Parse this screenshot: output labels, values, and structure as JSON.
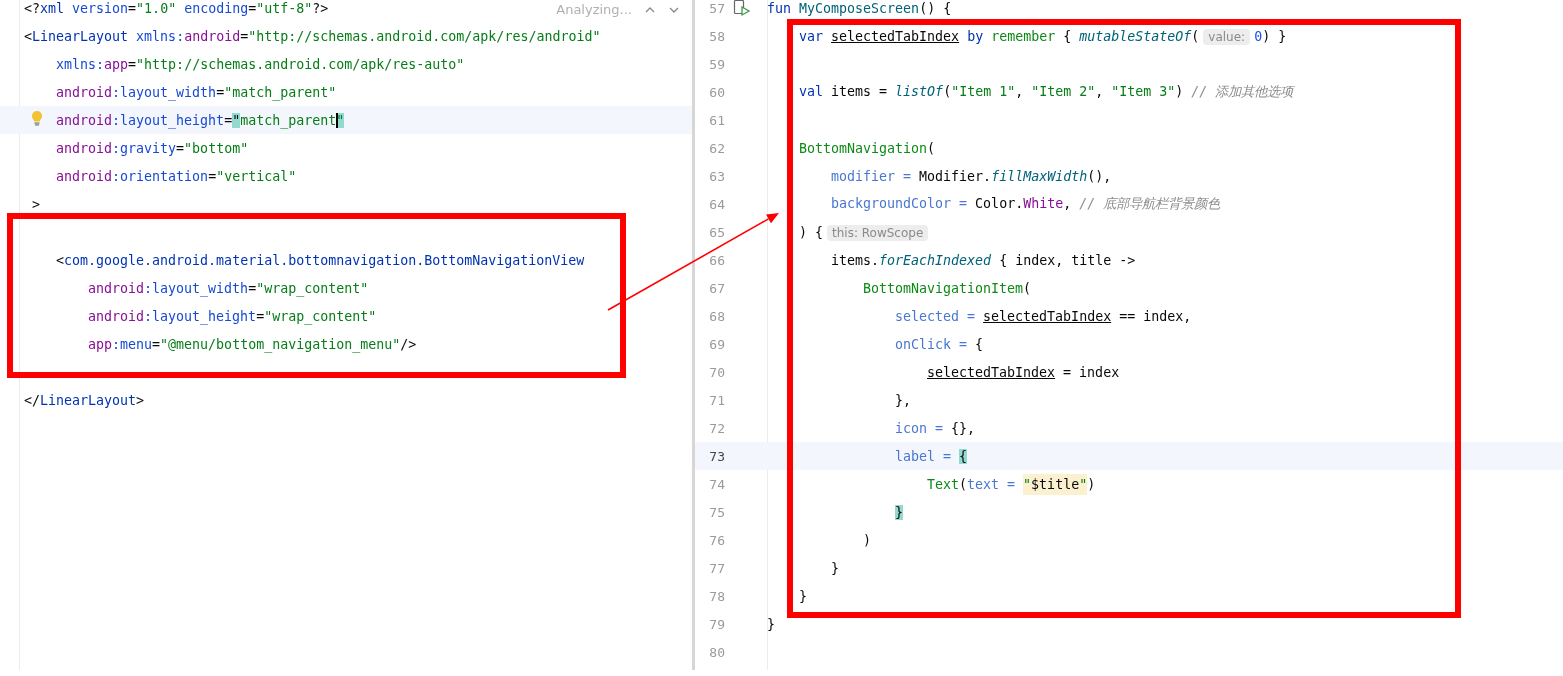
{
  "xml_editor": {
    "status": "Analyzing...",
    "lines": [
      {
        "kind": "code",
        "current": false,
        "bulb": false,
        "tokens": [
          {
            "text": "<?",
            "kind": "punct"
          },
          {
            "text": "xml",
            "kind": "tag"
          },
          {
            "text": " version",
            "kind": "attr"
          },
          {
            "text": "=",
            "kind": "punct"
          },
          {
            "text": "\"1.0\"",
            "kind": "string"
          },
          {
            "text": " encoding",
            "kind": "attr"
          },
          {
            "text": "=",
            "kind": "punct"
          },
          {
            "text": "\"utf-8\"",
            "kind": "string"
          },
          {
            "text": "?>",
            "kind": "punct"
          }
        ]
      },
      {
        "kind": "code",
        "current": false,
        "bulb": false,
        "tokens": [
          {
            "text": "<",
            "kind": "punct"
          },
          {
            "text": "LinearLayout",
            "kind": "tag"
          },
          {
            "text": " xmlns:",
            "kind": "attr"
          },
          {
            "text": "android",
            "kind": "ns"
          },
          {
            "text": "=",
            "kind": "punct"
          },
          {
            "text": "\"http://schemas.android.com/apk/res/android\"",
            "kind": "string"
          }
        ],
        "children": [
          {
            "kind": "code",
            "current": false,
            "bulb": false,
            "tokens": [
              {
                "text": "xmlns:",
                "kind": "attr"
              },
              {
                "text": "app",
                "kind": "ns"
              },
              {
                "text": "=",
                "kind": "punct"
              },
              {
                "text": "\"http://schemas.android.com/apk/res-auto\"",
                "kind": "string"
              }
            ]
          },
          {
            "kind": "code",
            "current": false,
            "bulb": false,
            "tokens": [
              {
                "text": "android",
                "kind": "ns"
              },
              {
                "text": ":layout_width",
                "kind": "attr"
              },
              {
                "text": "=",
                "kind": "punct"
              },
              {
                "text": "\"match_parent\"",
                "kind": "string"
              }
            ]
          },
          {
            "kind": "code",
            "current": true,
            "bulb": true,
            "tokens": [
              {
                "text": "android",
                "kind": "ns"
              },
              {
                "text": ":layout_height",
                "kind": "attr"
              },
              {
                "text": "=",
                "kind": "punct"
              },
              {
                "text": "\"",
                "kind": "match"
              },
              {
                "text": "match_parent",
                "kind": "string"
              },
              {
                "text": "\"",
                "kind": "match-caret"
              }
            ]
          },
          {
            "kind": "code",
            "current": false,
            "bulb": false,
            "tokens": [
              {
                "text": "android",
                "kind": "ns"
              },
              {
                "text": ":gravity",
                "kind": "attr"
              },
              {
                "text": "=",
                "kind": "punct"
              },
              {
                "text": "\"bottom\"",
                "kind": "string"
              }
            ]
          },
          {
            "kind": "code",
            "current": false,
            "bulb": false,
            "tokens": [
              {
                "text": "android",
                "kind": "ns"
              },
              {
                "text": ":orientation",
                "kind": "attr"
              },
              {
                "text": "=",
                "kind": "punct"
              },
              {
                "text": "\"vertical\"",
                "kind": "string"
              }
            ]
          }
        ]
      },
      {
        "kind": "code",
        "current": false,
        "bulb": false,
        "tokens": [
          {
            "text": " >",
            "kind": "punct"
          }
        ],
        "children": [
          {
            "kind": "blank",
            "current": false,
            "bulb": false
          },
          {
            "kind": "code",
            "current": false,
            "bulb": false,
            "tokens": [
              {
                "text": "<",
                "kind": "punct"
              },
              {
                "text": "com.google.android.material.bottomnavigation.BottomNavigationView",
                "kind": "tag"
              }
            ],
            "children": [
              {
                "kind": "code",
                "current": false,
                "bulb": false,
                "tokens": [
                  {
                    "text": "android",
                    "kind": "ns"
                  },
                  {
                    "text": ":layout_width",
                    "kind": "attr"
                  },
                  {
                    "text": "=",
                    "kind": "punct"
                  },
                  {
                    "text": "\"wrap_content\"",
                    "kind": "string"
                  }
                ]
              },
              {
                "kind": "code",
                "current": false,
                "bulb": false,
                "tokens": [
                  {
                    "text": "android",
                    "kind": "ns"
                  },
                  {
                    "text": ":layout_height",
                    "kind": "attr"
                  },
                  {
                    "text": "=",
                    "kind": "punct"
                  },
                  {
                    "text": "\"wrap_content\"",
                    "kind": "string"
                  }
                ]
              },
              {
                "kind": "code",
                "current": false,
                "bulb": false,
                "tokens": [
                  {
                    "text": "app",
                    "kind": "ns"
                  },
                  {
                    "text": ":menu",
                    "kind": "attr"
                  },
                  {
                    "text": "=",
                    "kind": "punct"
                  },
                  {
                    "text": "\"@menu/bottom_navigation_menu\"",
                    "kind": "string"
                  },
                  {
                    "text": "/>",
                    "kind": "punct"
                  }
                ]
              }
            ]
          }
        ]
      },
      {
        "kind": "blank",
        "current": false,
        "bulb": false
      },
      {
        "kind": "code",
        "current": false,
        "bulb": false,
        "tokens": [
          {
            "text": "</",
            "kind": "punct"
          },
          {
            "text": "LinearLayout",
            "kind": "tag"
          },
          {
            "text": ">",
            "kind": "punct"
          }
        ]
      }
    ]
  },
  "kotlin_editor": {
    "lines": [
      {
        "number": "57",
        "kind": "code",
        "current": false,
        "run": true,
        "tokens": [
          {
            "text": "fun ",
            "kind": "kw"
          },
          {
            "text": "MyComposeScreen",
            "kind": "func"
          },
          {
            "text": "() {",
            "kind": "punct"
          }
        ],
        "children": [
          {
            "number": "58",
            "kind": "code",
            "current": false,
            "run": false,
            "tokens": [
              {
                "text": "var ",
                "kind": "kw"
              },
              {
                "text": "selectedTabIndex",
                "kind": "var"
              },
              {
                "text": " by ",
                "kind": "kw"
              },
              {
                "text": "remember",
                "kind": "comp"
              },
              {
                "text": " { ",
                "kind": "punct"
              },
              {
                "text": "mutableStateOf",
                "kind": "ifunc"
              },
              {
                "text": "(",
                "kind": "punct"
              },
              {
                "text": "value:",
                "kind": "hint"
              },
              {
                "text": "0",
                "kind": "num"
              },
              {
                "text": ") }",
                "kind": "punct"
              }
            ]
          },
          {
            "number": "59",
            "kind": "blank",
            "current": false,
            "run": false
          },
          {
            "number": "60",
            "kind": "code",
            "current": false,
            "run": false,
            "tokens": [
              {
                "text": "val ",
                "kind": "kw"
              },
              {
                "text": "items = ",
                "kind": "punct"
              },
              {
                "text": "listOf",
                "kind": "ifunc"
              },
              {
                "text": "(",
                "kind": "punct"
              },
              {
                "text": "\"Item 1\"",
                "kind": "string"
              },
              {
                "text": ", ",
                "kind": "punct"
              },
              {
                "text": "\"Item 2\"",
                "kind": "string"
              },
              {
                "text": ", ",
                "kind": "punct"
              },
              {
                "text": "\"Item 3\"",
                "kind": "string"
              },
              {
                "text": ") ",
                "kind": "punct"
              },
              {
                "text": "// 添加其他选项",
                "kind": "comment"
              }
            ]
          },
          {
            "number": "61",
            "kind": "blank",
            "current": false,
            "run": false
          },
          {
            "number": "62",
            "kind": "code",
            "current": false,
            "run": false,
            "tokens": [
              {
                "text": "BottomNavigation",
                "kind": "comp"
              },
              {
                "text": "(",
                "kind": "punct"
              }
            ],
            "children": [
              {
                "number": "63",
                "kind": "code",
                "current": false,
                "run": false,
                "tokens": [
                  {
                    "text": "modifier = ",
                    "kind": "named"
                  },
                  {
                    "text": "Modifier.",
                    "kind": "punct"
                  },
                  {
                    "text": "fillMaxWidth",
                    "kind": "ifunc"
                  },
                  {
                    "text": "(),",
                    "kind": "punct"
                  }
                ]
              },
              {
                "number": "64",
                "kind": "code",
                "current": false,
                "run": false,
                "tokens": [
                  {
                    "text": "backgroundColor = ",
                    "kind": "named"
                  },
                  {
                    "text": "Color.",
                    "kind": "punct"
                  },
                  {
                    "text": "White",
                    "kind": "prop"
                  },
                  {
                    "text": ", ",
                    "kind": "punct"
                  },
                  {
                    "text": "// 底部导航栏背景颜色",
                    "kind": "comment"
                  }
                ]
              }
            ]
          },
          {
            "number": "65",
            "kind": "code",
            "current": false,
            "run": false,
            "tokens": [
              {
                "text": ") {",
                "kind": "punct"
              },
              {
                "text": "this: RowScope",
                "kind": "hint"
              }
            ],
            "children": [
              {
                "number": "66",
                "kind": "code",
                "current": false,
                "run": false,
                "tokens": [
                  {
                    "text": "items.",
                    "kind": "punct"
                  },
                  {
                    "text": "forEachIndexed",
                    "kind": "ifunc"
                  },
                  {
                    "text": " { index, title ->",
                    "kind": "punct"
                  }
                ],
                "children": [
                  {
                    "number": "67",
                    "kind": "code",
                    "current": false,
                    "run": false,
                    "tokens": [
                      {
                        "text": "BottomNavigationItem",
                        "kind": "comp"
                      },
                      {
                        "text": "(",
                        "kind": "punct"
                      }
                    ],
                    "children": [
                      {
                        "number": "68",
                        "kind": "code",
                        "current": false,
                        "run": false,
                        "tokens": [
                          {
                            "text": "selected = ",
                            "kind": "named"
                          },
                          {
                            "text": "selectedTabIndex",
                            "kind": "var"
                          },
                          {
                            "text": " == index,",
                            "kind": "punct"
                          }
                        ]
                      },
                      {
                        "number": "69",
                        "kind": "code",
                        "current": false,
                        "run": false,
                        "tokens": [
                          {
                            "text": "onClick = ",
                            "kind": "named"
                          },
                          {
                            "text": "{",
                            "kind": "punct"
                          }
                        ],
                        "children": [
                          {
                            "number": "70",
                            "kind": "code",
                            "current": false,
                            "run": false,
                            "tokens": [
                              {
                                "text": "selectedTabIndex",
                                "kind": "var"
                              },
                              {
                                "text": " = index",
                                "kind": "punct"
                              }
                            ]
                          }
                        ]
                      },
                      {
                        "number": "71",
                        "kind": "code",
                        "current": false,
                        "run": false,
                        "tokens": [
                          {
                            "text": "},",
                            "kind": "punct"
                          }
                        ]
                      },
                      {
                        "number": "72",
                        "kind": "code",
                        "current": false,
                        "run": false,
                        "tokens": [
                          {
                            "text": "icon = ",
                            "kind": "named"
                          },
                          {
                            "text": "{},",
                            "kind": "punct"
                          }
                        ]
                      },
                      {
                        "number": "73",
                        "kind": "code",
                        "current": true,
                        "run": false,
                        "tokens": [
                          {
                            "text": "label = ",
                            "kind": "named"
                          },
                          {
                            "text": "{",
                            "kind": "match"
                          }
                        ],
                        "children": [
                          {
                            "number": "74",
                            "kind": "code",
                            "current": false,
                            "run": false,
                            "tokens": [
                              {
                                "text": "Text",
                                "kind": "comp"
                              },
                              {
                                "text": "(",
                                "kind": "punct"
                              },
                              {
                                "text": "text = ",
                                "kind": "named"
                              },
                              {
                                "text": "\"",
                                "kind": "hlq"
                              },
                              {
                                "text": "$title",
                                "kind": "hlv"
                              },
                              {
                                "text": "\"",
                                "kind": "hlq"
                              },
                              {
                                "text": ")",
                                "kind": "punct"
                              }
                            ]
                          }
                        ]
                      },
                      {
                        "number": "75",
                        "kind": "code",
                        "current": false,
                        "run": false,
                        "tokens": [
                          {
                            "text": "}",
                            "kind": "match"
                          }
                        ]
                      }
                    ]
                  },
                  {
                    "number": "76",
                    "kind": "code",
                    "current": false,
                    "run": false,
                    "tokens": [
                      {
                        "text": ")",
                        "kind": "punct"
                      }
                    ]
                  }
                ]
              },
              {
                "number": "77",
                "kind": "code",
                "current": false,
                "run": false,
                "tokens": [
                  {
                    "text": "}",
                    "kind": "punct"
                  }
                ]
              }
            ]
          },
          {
            "number": "78",
            "kind": "code",
            "current": false,
            "run": false,
            "tokens": [
              {
                "text": "}",
                "kind": "punct"
              }
            ]
          }
        ]
      },
      {
        "number": "79",
        "kind": "code",
        "current": false,
        "run": false,
        "tokens": [
          {
            "text": "}",
            "kind": "punct"
          }
        ]
      },
      {
        "number": "80",
        "kind": "blank",
        "current": false,
        "run": false
      }
    ]
  }
}
